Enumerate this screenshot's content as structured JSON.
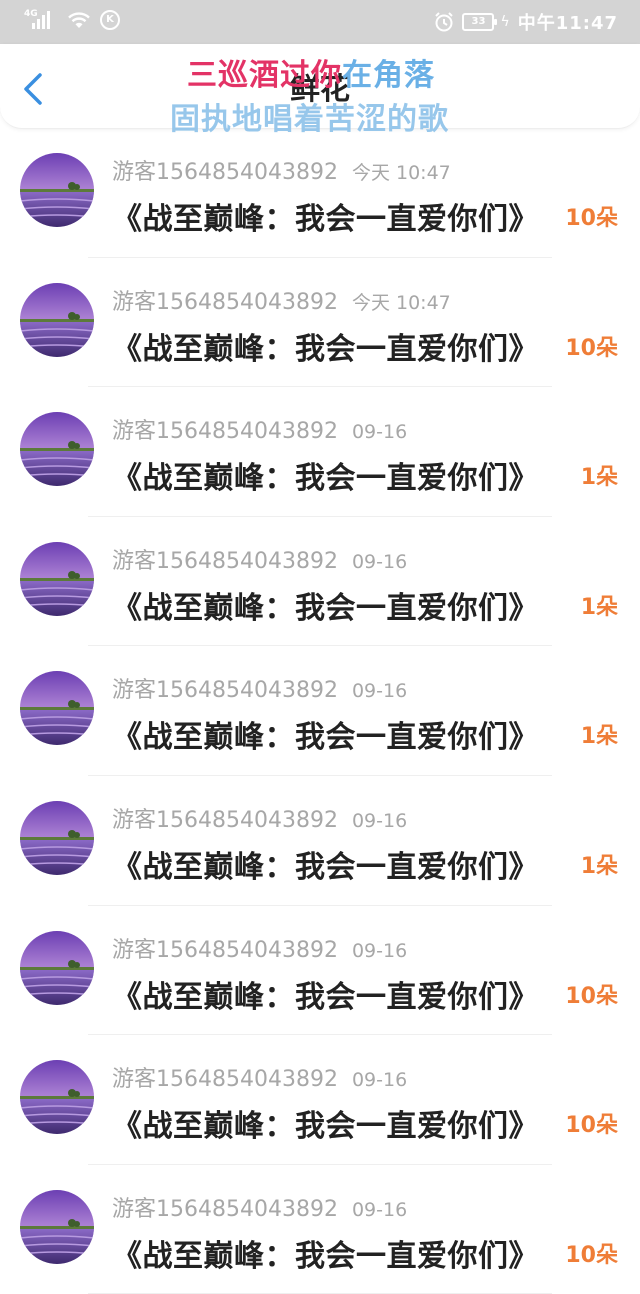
{
  "status_bar": {
    "network": "4G",
    "carrier_badge": "K",
    "battery": "33",
    "time": "中午11:47",
    "icons": [
      "signal-icon",
      "wifi-icon",
      "alarm-icon",
      "battery-icon",
      "charging-icon"
    ]
  },
  "header": {
    "title": "鲜花",
    "back_icon": "chevron-left-icon"
  },
  "lyrics": {
    "line1_part1": "三巡酒过你",
    "line1_part2": "在角落",
    "line2": "固执地唱着苦涩的歌"
  },
  "colors": {
    "lyric_pink": "#e33366",
    "lyric_blue": "#6ab0e6",
    "flower_count": "#ef7d37",
    "back_arrow": "#3a8fe0"
  },
  "items": [
    {
      "user": "游客1564854043892",
      "time": "今天 10:47",
      "title": "《战至巅峰：我会一直爱你们》",
      "flowers": "10朵"
    },
    {
      "user": "游客1564854043892",
      "time": "今天 10:47",
      "title": "《战至巅峰：我会一直爱你们》",
      "flowers": "10朵"
    },
    {
      "user": "游客1564854043892",
      "time": "09-16",
      "title": "《战至巅峰：我会一直爱你们》",
      "flowers": "1朵"
    },
    {
      "user": "游客1564854043892",
      "time": "09-16",
      "title": "《战至巅峰：我会一直爱你们》",
      "flowers": "1朵"
    },
    {
      "user": "游客1564854043892",
      "time": "09-16",
      "title": "《战至巅峰：我会一直爱你们》",
      "flowers": "1朵"
    },
    {
      "user": "游客1564854043892",
      "time": "09-16",
      "title": "《战至巅峰：我会一直爱你们》",
      "flowers": "1朵"
    },
    {
      "user": "游客1564854043892",
      "time": "09-16",
      "title": "《战至巅峰：我会一直爱你们》",
      "flowers": "10朵"
    },
    {
      "user": "游客1564854043892",
      "time": "09-16",
      "title": "《战至巅峰：我会一直爱你们》",
      "flowers": "10朵"
    },
    {
      "user": "游客1564854043892",
      "time": "09-16",
      "title": "《战至巅峰：我会一直爱你们》",
      "flowers": "10朵"
    }
  ]
}
